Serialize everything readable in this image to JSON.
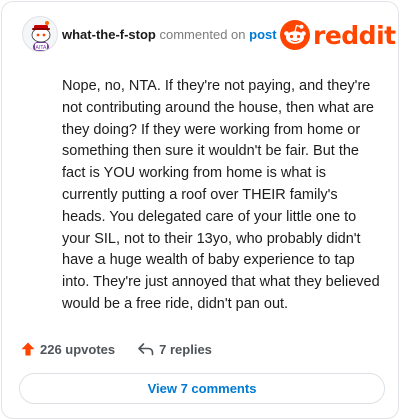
{
  "header": {
    "username": "what-the-f-stop",
    "action_text": "commented on",
    "post_link": "post",
    "brand": "reddit"
  },
  "comment": {
    "body": "Nope, no, NTA. If they're not paying, and they're not contributing around the house, then what are they doing? If they were working from home or something then sure it wouldn't be fair. But the fact is YOU working from home is what is currently putting a roof over THEIR family's heads. You delegated care of your little one to your SIL, not to their 13yo, who probably didn't have a huge wealth of baby experience to tap into. They're just annoyed that what they believed would be a free ride, didn't pan out."
  },
  "actions": {
    "upvotes": "226 upvotes",
    "replies": "7 replies",
    "view_comments": "View 7 comments"
  },
  "colors": {
    "brand_orange": "#ff4500",
    "link_blue": "#0079d3",
    "upvote_icon": "#ff4500"
  },
  "icons": {
    "avatar": "snoo-avatar",
    "logo": "reddit-snoo-icon",
    "upvote": "upvote-arrow-icon",
    "reply": "reply-arrow-icon"
  }
}
